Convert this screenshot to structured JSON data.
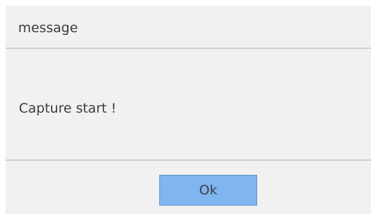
{
  "dialog": {
    "title": "message",
    "message": "Capture start !",
    "ok_label": "Ok"
  }
}
